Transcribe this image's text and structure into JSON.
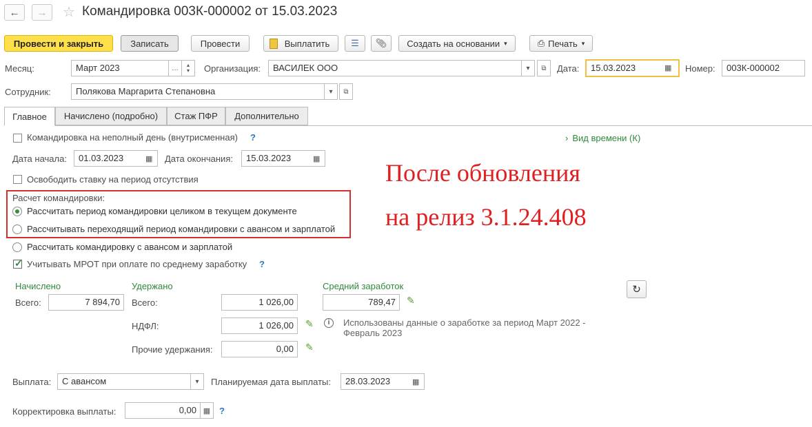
{
  "window": {
    "title": "Командировка 003К-000002 от 15.03.2023",
    "nav_back_icon": "arrow-left-icon",
    "nav_forward_icon": "arrow-right-icon",
    "favorite_icon": "star-icon"
  },
  "toolbar": {
    "post_close": "Провести и закрыть",
    "save": "Записать",
    "post": "Провести",
    "pay": "Выплатить",
    "create_based": "Создать на основании",
    "print": "Печать"
  },
  "header": {
    "month_label": "Месяц:",
    "month_value": "Март 2023",
    "org_label": "Организация:",
    "org_value": "ВАСИЛЕК ООО",
    "date_label": "Дата:",
    "date_value": "15.03.2023",
    "number_label": "Номер:",
    "number_value": "003К-000002",
    "employee_label": "Сотрудник:",
    "employee_value": "Полякова Маргарита Степановна"
  },
  "tabs": [
    {
      "label": "Главное"
    },
    {
      "label": "Начислено (подробно)"
    },
    {
      "label": "Стаж ПФР"
    },
    {
      "label": "Дополнительно"
    }
  ],
  "main": {
    "partial_day_label": "Командировка на неполный день (внутрисменная)",
    "time_type_link": "Вид времени (К)",
    "start_label": "Дата начала:",
    "start_value": "01.03.2023",
    "end_label": "Дата окончания:",
    "end_value": "15.03.2023",
    "free_rate_label": "Освободить ставку на период отсутствия",
    "calc_title": "Расчет командировки:",
    "calc_opt1": "Рассчитать период командировки целиком в текущем документе",
    "calc_opt2": "Рассчитывать переходящий период командировки с авансом и зарплатой",
    "calc_opt3": "Рассчитать командировку с авансом и зарплатой",
    "mrot_label": "Учитывать МРОТ при оплате по среднему заработку",
    "accrued_title": "Начислено",
    "accrued_total_label": "Всего:",
    "accrued_total": "7 894,70",
    "withheld_title": "Удержано",
    "withheld_total_label": "Всего:",
    "withheld_total": "1 026,00",
    "ndfl_label": "НДФЛ:",
    "ndfl_value": "1 026,00",
    "other_label": "Прочие удержания:",
    "other_value": "0,00",
    "avg_title": "Средний заработок",
    "avg_value": "789,47",
    "info_text_1": "Использованы данные о заработке за период Март 2022 -",
    "info_text_2": "Февраль 2023",
    "payout_label": "Выплата:",
    "payout_value": "С авансом",
    "plan_date_label": "Планируемая дата выплаты:",
    "plan_date_value": "28.03.2023",
    "correction_label": "Корректировка выплаты:",
    "correction_value": "0,00",
    "help_mark": "?"
  },
  "annotation": {
    "line1": "После обновления",
    "line2": "на релиз 3.1.24.408",
    "color": "#e02020"
  },
  "colors": {
    "primary_button": "#ffe04b",
    "highlight_border": "#d32f2f",
    "date_focus_border": "#f0c040",
    "section_green": "#2f8a3a"
  }
}
